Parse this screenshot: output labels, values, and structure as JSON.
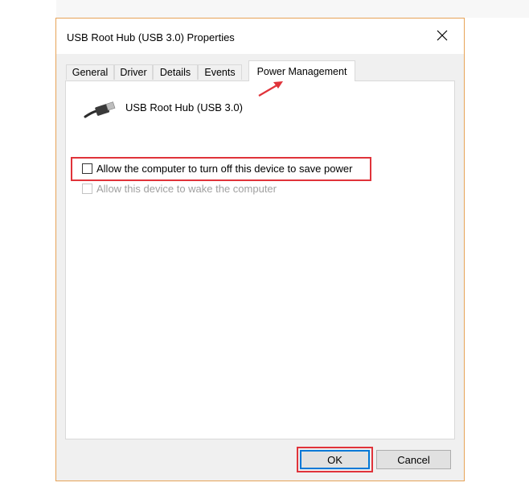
{
  "dialog": {
    "title": "USB Root Hub (USB 3.0) Properties",
    "close_glyph": "✕"
  },
  "tabs": [
    {
      "label": "General",
      "active": false
    },
    {
      "label": "Driver",
      "active": false
    },
    {
      "label": "Details",
      "active": false
    },
    {
      "label": "Events",
      "active": false
    },
    {
      "label": "Power Management",
      "active": true
    }
  ],
  "device": {
    "icon": "usb-cable-icon",
    "name": "USB Root Hub (USB 3.0)"
  },
  "options": [
    {
      "label": "Allow the computer to turn off this device to save power",
      "checked": false,
      "enabled": true
    },
    {
      "label": "Allow this device to wake the computer",
      "checked": false,
      "enabled": false
    }
  ],
  "buttons": {
    "ok": "OK",
    "cancel": "Cancel"
  },
  "annotations": {
    "highlight_color": "#e0333a",
    "arrow_color": "#e0333a"
  }
}
